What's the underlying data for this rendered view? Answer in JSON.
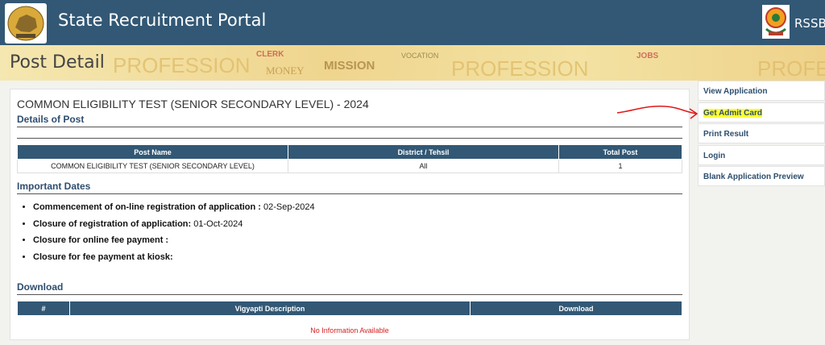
{
  "header": {
    "title": "State Recruitment Portal",
    "brand": "RSSB"
  },
  "banner": {
    "title": "Post Detail",
    "watermark_words": [
      "PROFESSION",
      "CLERK",
      "MONEY",
      "MISSION",
      "VOCATION",
      "PROFESSION",
      "JOBS",
      "PROFE"
    ]
  },
  "post": {
    "heading": "COMMON ELIGIBILITY TEST (SENIOR SECONDARY LEVEL) - 2024",
    "details_title": "Details of Post",
    "table": {
      "headers": [
        "Post Name",
        "District / Tehsil",
        "Total Post"
      ],
      "rows": [
        [
          "COMMON ELIGIBILITY TEST (SENIOR SECONDARY LEVEL)",
          "All",
          "1"
        ]
      ]
    },
    "important_dates_title": "Important Dates",
    "dates": [
      {
        "label": "Commencement of on-line registration of application :",
        "value": " 02-Sep-2024"
      },
      {
        "label": "Closure of registration of application:",
        "value": " 01-Oct-2024"
      },
      {
        "label": "Closure for online fee payment :",
        "value": ""
      },
      {
        "label": "Closure for fee payment at kiosk:",
        "value": ""
      }
    ],
    "download_title": "Download",
    "download_table": {
      "headers": [
        "#",
        "Vigyapti Description",
        "Download"
      ],
      "empty_text": "No Information Available"
    }
  },
  "sidebar": {
    "items": [
      {
        "label": "View Application"
      },
      {
        "label": "Get Admit Card",
        "highlighted": true
      },
      {
        "label": "Print Result"
      },
      {
        "label": "Login"
      },
      {
        "label": "Blank Application Preview"
      }
    ]
  },
  "colors": {
    "header_bg": "#325875",
    "highlight": "#ffff33",
    "annotation": "#e01818",
    "link": "#2e4e6e"
  }
}
